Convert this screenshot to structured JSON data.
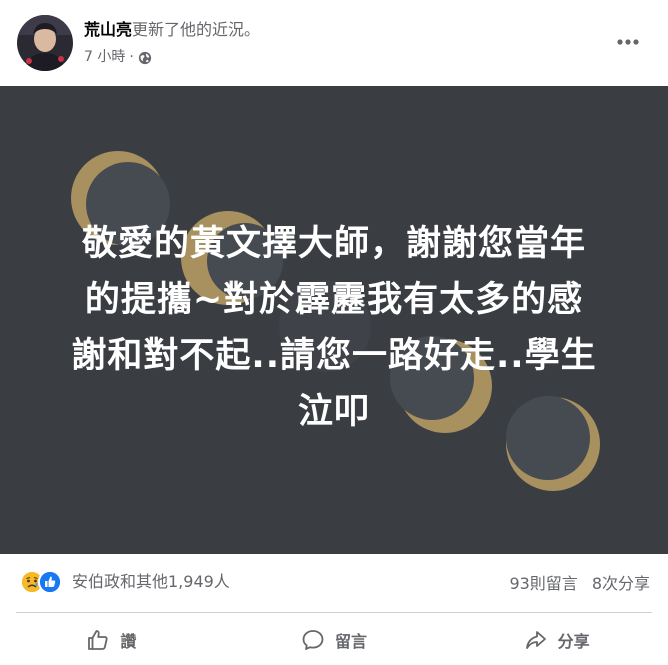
{
  "post": {
    "author_name": "荒山亮",
    "action_text": "更新了他的近況。",
    "time": "7 小時",
    "time_separator": "·",
    "audience_icon": "globe-icon",
    "more_icon": "more-dots-icon"
  },
  "image": {
    "text_lines": [
      "敬愛的黃文擇大師，謝謝您當年",
      "的提攜~對於霹靂我有太多的感",
      "謝和對不起..請您一路好走..學生",
      "泣叩"
    ],
    "background_color": "#3a3e43",
    "moon_color": "#a8915e"
  },
  "stats": {
    "reaction_icons": [
      "sad-reaction-icon",
      "like-reaction-icon"
    ],
    "reaction_summary": "安伯政和其他1,949人",
    "comments": "93則留言",
    "shares": "8次分享"
  },
  "actions": {
    "like": "讚",
    "comment": "留言",
    "share": "分享"
  }
}
